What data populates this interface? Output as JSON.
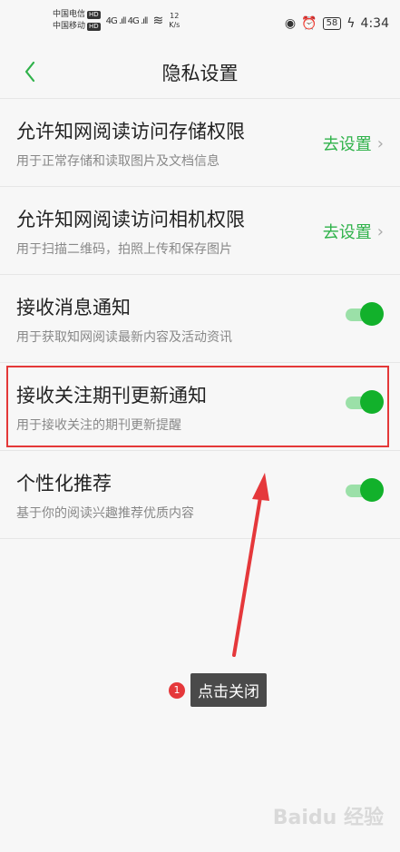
{
  "status": {
    "carrier1": "中国电信",
    "carrier1_badge": "HD",
    "carrier2": "中国移动",
    "carrier2_badge": "HD",
    "signal": "4G .ıll 4G .ıll",
    "speed_value": "12",
    "speed_unit": "K/s",
    "battery": "58",
    "time": "4:34"
  },
  "header": {
    "title": "隐私设置"
  },
  "rows": [
    {
      "title": "允许知网阅读访问存储权限",
      "subtitle": "用于正常存储和读取图片及文档信息",
      "action": "去设置"
    },
    {
      "title": "允许知网阅读访问相机权限",
      "subtitle": "用于扫描二维码，拍照上传和保存图片",
      "action": "去设置"
    },
    {
      "title": "接收消息通知",
      "subtitle": "用于获取知网阅读最新内容及活动资讯",
      "enabled": true
    },
    {
      "title": "接收关注期刊更新通知",
      "subtitle": "用于接收关注的期刊更新提醒",
      "enabled": true
    },
    {
      "title": "个性化推荐",
      "subtitle": "基于你的阅读兴趣推荐优质内容",
      "enabled": true
    }
  ],
  "annotation": {
    "step": "1",
    "text": "点击关闭"
  },
  "watermark": "Baidu 经验",
  "colors": {
    "accent": "#2fb24a",
    "highlight": "#e43838"
  }
}
